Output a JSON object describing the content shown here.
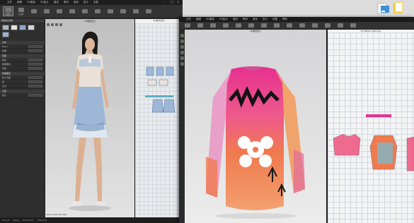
{
  "winA": {
    "menu": [
      "文件",
      "编辑",
      "3D服装",
      "2D板片",
      "缝纫",
      "素材",
      "渲染",
      "显示",
      "设置"
    ],
    "toolbar": [
      "模拟",
      "高品质",
      "",
      "",
      "",
      "",
      "",
      "",
      "",
      "",
      "",
      ""
    ],
    "sidebar": {
      "title": "物体窗/资源",
      "rows": [
        {
          "k": "Fabric",
          "v": ""
        },
        {
          "k": "纹理",
          "v": ""
        },
        {
          "k": "颜色",
          "v": ""
        },
        {
          "k": "物理属性",
          "v": ""
        },
        {
          "k": "厚度",
          "v": ""
        },
        {
          "k": "粒子间距",
          "v": ""
        },
        {
          "k": "层",
          "v": ""
        },
        {
          "k": "压力",
          "v": ""
        },
        {
          "k": "板片",
          "v": ""
        }
      ],
      "sections": [
        "基本",
        "纹理",
        "物理属性",
        "渲染"
      ]
    },
    "viewport_title": "3D服装窗口",
    "viewport_footer": "Pants Crash  DAT 2021",
    "pattern_title": "2D板片窗口",
    "status": [
      "V6.x.xx",
      "Ready",
      "Grid 10mm",
      "Total 0.0s"
    ]
  },
  "winB": {
    "menu": [
      "文件",
      "编辑",
      "3D服装",
      "2D板片",
      "缝纫",
      "素材",
      "渲染",
      "显示",
      "设置",
      "帮助"
    ],
    "view3d_title": "3D服装窗口",
    "view2d_title": "2D Pattern Window"
  },
  "colors": {
    "dress_top": "#e9e1d8",
    "dress_blue": "#9eb7d6",
    "shirt_pink": "#e6308f",
    "shirt_orange": "#f07a4e"
  }
}
